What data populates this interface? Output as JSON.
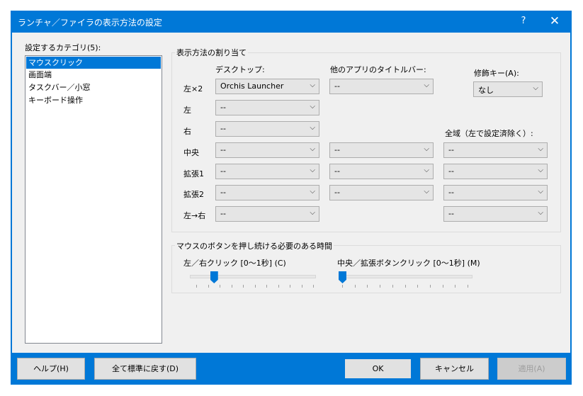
{
  "window": {
    "title": "ランチャ／ファイラの表示方法の設定",
    "help": "?",
    "close": "✕"
  },
  "sidebar": {
    "heading": "設定するカテゴリ(5):",
    "items": [
      {
        "label": "マウスクリック",
        "selected": true
      },
      {
        "label": "画面端"
      },
      {
        "label": "タスクバー／小窓"
      },
      {
        "label": "キーボード操作"
      }
    ]
  },
  "assign_group": {
    "title": "表示方法の割り当て",
    "col_desktop": "デスクトップ:",
    "col_titlebar": "他のアプリのタイトルバー:",
    "col_modifier": "修飾キー(A):",
    "modifier_value": "なし",
    "col_global": "全域（左で設定済除く）:",
    "rows": [
      {
        "label": "左×2",
        "desktop": "Orchis Launcher",
        "titlebar": "--"
      },
      {
        "label": "左",
        "desktop": "--"
      },
      {
        "label": "右",
        "desktop": "--"
      },
      {
        "label": "中央",
        "desktop": "--",
        "titlebar": "--",
        "global": "--"
      },
      {
        "label": "拡張1",
        "desktop": "--",
        "titlebar": "--",
        "global": "--"
      },
      {
        "label": "拡張2",
        "desktop": "--",
        "titlebar": "--",
        "global": "--"
      },
      {
        "label": "左→右",
        "desktop": "--",
        "global": "--"
      }
    ]
  },
  "hold_group": {
    "title": "マウスのボタンを押し続ける必要のある時間",
    "slider1_label": "左／右クリック [0〜1秒] (C)",
    "slider1_value": 0.15,
    "slider2_label": "中央／拡張ボタンクリック [0〜1秒] (M)",
    "slider2_value": 0.0
  },
  "buttons": {
    "help": "ヘルプ(H)",
    "reset": "全て標準に戻す(D)",
    "ok": "OK",
    "cancel": "キャンセル",
    "apply": "適用(A)"
  },
  "colors": {
    "accent": "#0078d7",
    "dialog_bg": "#f0f0f0",
    "combo_bg": "#e5e5e5"
  }
}
